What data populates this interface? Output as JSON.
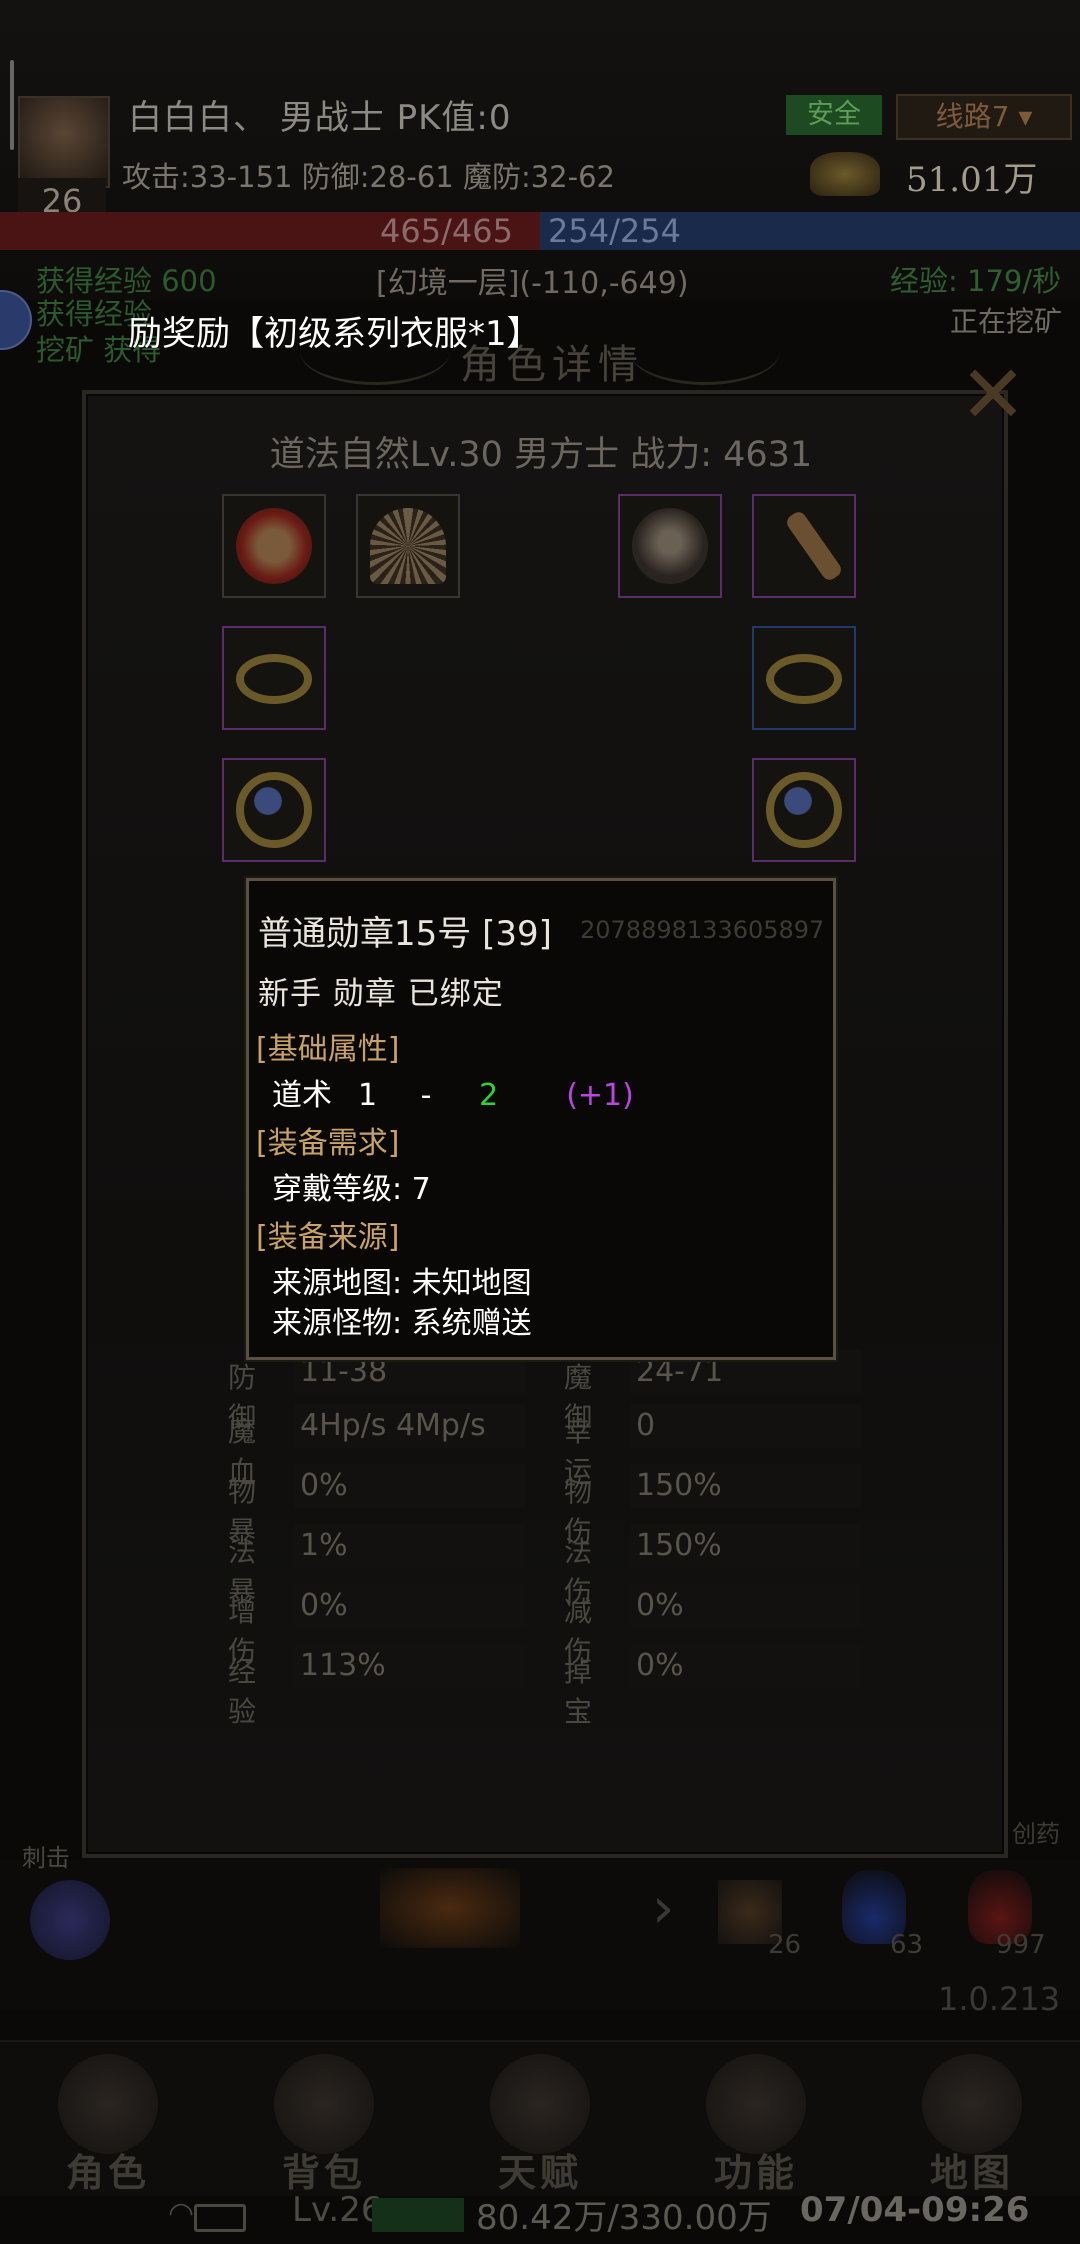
{
  "hud": {
    "player_name_line": "白白白、 男战士 PK值:0",
    "level": "26",
    "stats_line": "攻击:33-151 防御:28-61 魔防:32-62",
    "safe_label": "安全",
    "route_label": "线路7",
    "gold": "51.01万",
    "hp": "465/465",
    "mp": "254/254",
    "map_location": "[幻境一层](-110,-649)",
    "exp_gain": "获得经验 600",
    "exp_rate": "经验: 179/秒",
    "mining_status": "正在挖矿",
    "log_lines": [
      "获得经验",
      "挖矿 获得"
    ],
    "reward_message": "励奖励【初级系列衣服*1】"
  },
  "panel": {
    "title": "角色详情",
    "character_header": "道法自然Lv.30 男方士  战力: 4631",
    "equipment_slots": [
      {
        "name": "medal-slot",
        "tier": "normal",
        "icon": "medal-icon"
      },
      {
        "name": "shoulder-slot",
        "tier": "normal",
        "icon": "shell-icon"
      },
      {
        "name": "helmet-slot",
        "tier": "purple",
        "icon": "skull-helmet-icon"
      },
      {
        "name": "whip-slot",
        "tier": "purple",
        "icon": "whip-icon"
      },
      {
        "name": "bracelet-left-slot",
        "tier": "purple",
        "icon": "bracelet-icon"
      },
      {
        "name": "bracelet-right-slot",
        "tier": "blue",
        "icon": "bracelet-icon"
      },
      {
        "name": "ring-left-slot",
        "tier": "purple",
        "icon": "ring-icon"
      },
      {
        "name": "ring-right-slot",
        "tier": "purple",
        "icon": "ring-icon"
      }
    ],
    "attributes": [
      {
        "left_label": "防御",
        "left_value": "11-38",
        "right_label": "魔御",
        "right_value": "24-71"
      },
      {
        "left_label": "魔血",
        "left_value": "4Hp/s   4Mp/s",
        "right_label": "幸运",
        "right_value": "0"
      },
      {
        "left_label": "物暴",
        "left_value": "0%",
        "right_label": "物伤",
        "right_value": "150%"
      },
      {
        "left_label": "法暴",
        "left_value": "1%",
        "right_label": "法伤",
        "right_value": "150%"
      },
      {
        "left_label": "增伤",
        "left_value": "0%",
        "right_label": "减伤",
        "right_value": "0%"
      },
      {
        "left_label": "经验",
        "left_value": "113%",
        "right_label": "掉宝",
        "right_value": "0%"
      }
    ]
  },
  "tooltip": {
    "title": "普通勋章15号 [39]",
    "item_id": "2078898133605897",
    "subtitle": "新手 勋章 已绑定",
    "section_base": "[基础属性]",
    "stat_name": "道术",
    "stat_min": "1",
    "stat_dash": "-",
    "stat_max": "2",
    "stat_bonus": "(+1)",
    "section_req": "[装备需求]",
    "req_line": "穿戴等级: 7",
    "section_source": "[装备来源]",
    "source_map": "来源地图:  未知地图",
    "source_monster": "来源怪物:  系统赠送"
  },
  "skillbar": {
    "left_label": "刺击",
    "item_counts": [
      "26",
      "63",
      "997"
    ],
    "version": "1.0.213",
    "right_hint": "创药"
  },
  "nav": [
    {
      "label": "角色",
      "icon": "hooded-figure-icon"
    },
    {
      "label": "背包",
      "icon": "bag-icon"
    },
    {
      "label": "天赋",
      "icon": "talent-emblem-icon"
    },
    {
      "label": "功能",
      "icon": "blade-icon"
    },
    {
      "label": "地图",
      "icon": "map-scroll-icon"
    }
  ],
  "status": {
    "level": "Lv.26",
    "exp": "80.42万/330.00万",
    "time": "07/04-09:26"
  }
}
